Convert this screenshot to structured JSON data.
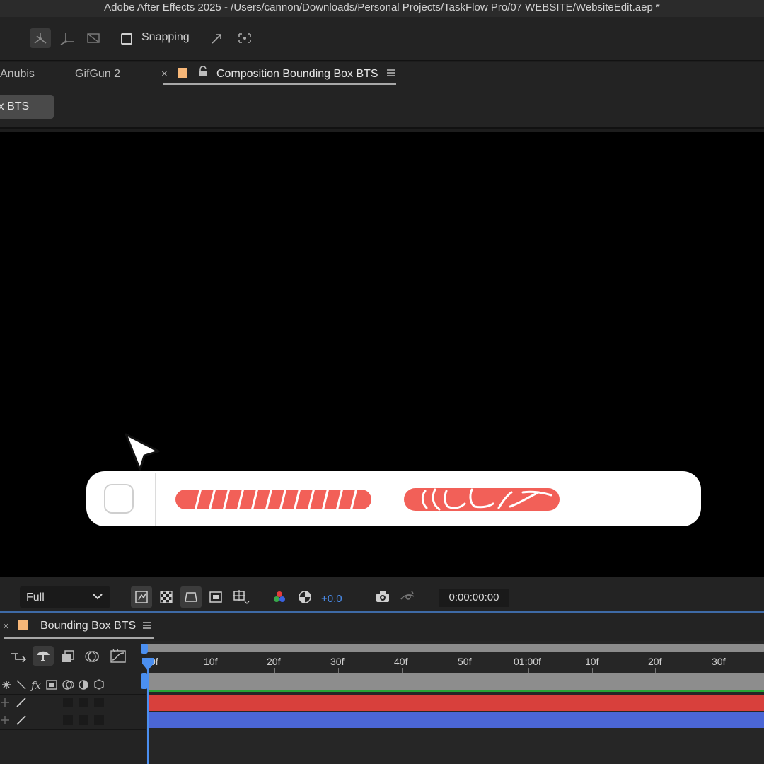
{
  "window": {
    "title": "Adobe After Effects 2025 - /Users/cannon/Downloads/Personal Projects/TaskFlow Pro/07 WEBSITE/WebsiteEdit.aep *"
  },
  "toolbar": {
    "snapping_label": "Snapping",
    "icons": [
      "local-axis-icon",
      "world-axis-icon",
      "view-axis-icon",
      "snap-box",
      "align-icon",
      "snap-target-icon"
    ]
  },
  "tabs": {
    "items": [
      "Anubis",
      "GifGun 2"
    ],
    "active": "Composition Bounding Box BTS",
    "close_glyph": "×",
    "swatch_color": "#f7b778"
  },
  "breadcrumb": {
    "label": "Bounding Box BTS"
  },
  "canvas": {
    "background": "#000000",
    "pill_color": "#ffffff",
    "bar_color": "#f26058"
  },
  "viewer_controls": {
    "resolution": "Full",
    "exposure": "+0.0",
    "timecode": "0:00:00:00"
  },
  "timeline": {
    "comp_name": "Bounding Box BTS",
    "close_glyph": "×",
    "ruler_labels": [
      "0f",
      "10f",
      "20f",
      "30f",
      "40f",
      "50f",
      "01:00f",
      "10f",
      "20f",
      "30f"
    ],
    "layer_colors": [
      "#d8403c",
      "#4b66d6"
    ]
  }
}
